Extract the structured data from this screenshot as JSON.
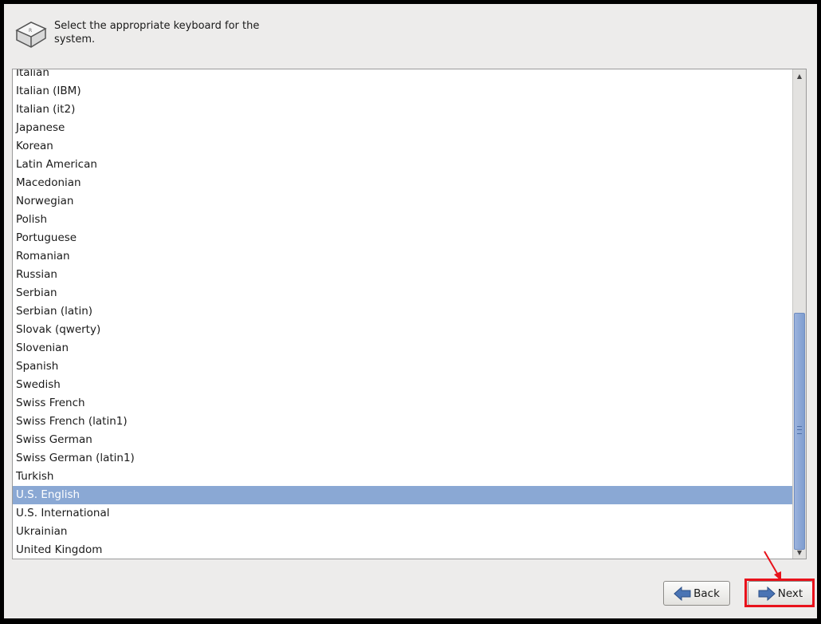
{
  "header": {
    "icon": "keyboard-key-icon",
    "prompt": "Select the appropriate keyboard for the system."
  },
  "keyboard_list": {
    "items": [
      "Italian",
      "Italian (IBM)",
      "Italian (it2)",
      "Japanese",
      "Korean",
      "Latin American",
      "Macedonian",
      "Norwegian",
      "Polish",
      "Portuguese",
      "Romanian",
      "Russian",
      "Serbian",
      "Serbian (latin)",
      "Slovak (qwerty)",
      "Slovenian",
      "Spanish",
      "Swedish",
      "Swiss French",
      "Swiss French (latin1)",
      "Swiss German",
      "Swiss German (latin1)",
      "Turkish",
      "U.S. English",
      "U.S. International",
      "Ukrainian",
      "United Kingdom"
    ],
    "selected": "U.S. English",
    "selection_color": "#8aa8d4",
    "scroll_position": 0.9
  },
  "buttons": {
    "back_label": "Back",
    "back_icon": "arrow-left-icon",
    "next_label": "Next",
    "next_icon": "arrow-right-icon"
  },
  "annotation": {
    "highlight_color": "#e8121b",
    "target": "next-button"
  }
}
